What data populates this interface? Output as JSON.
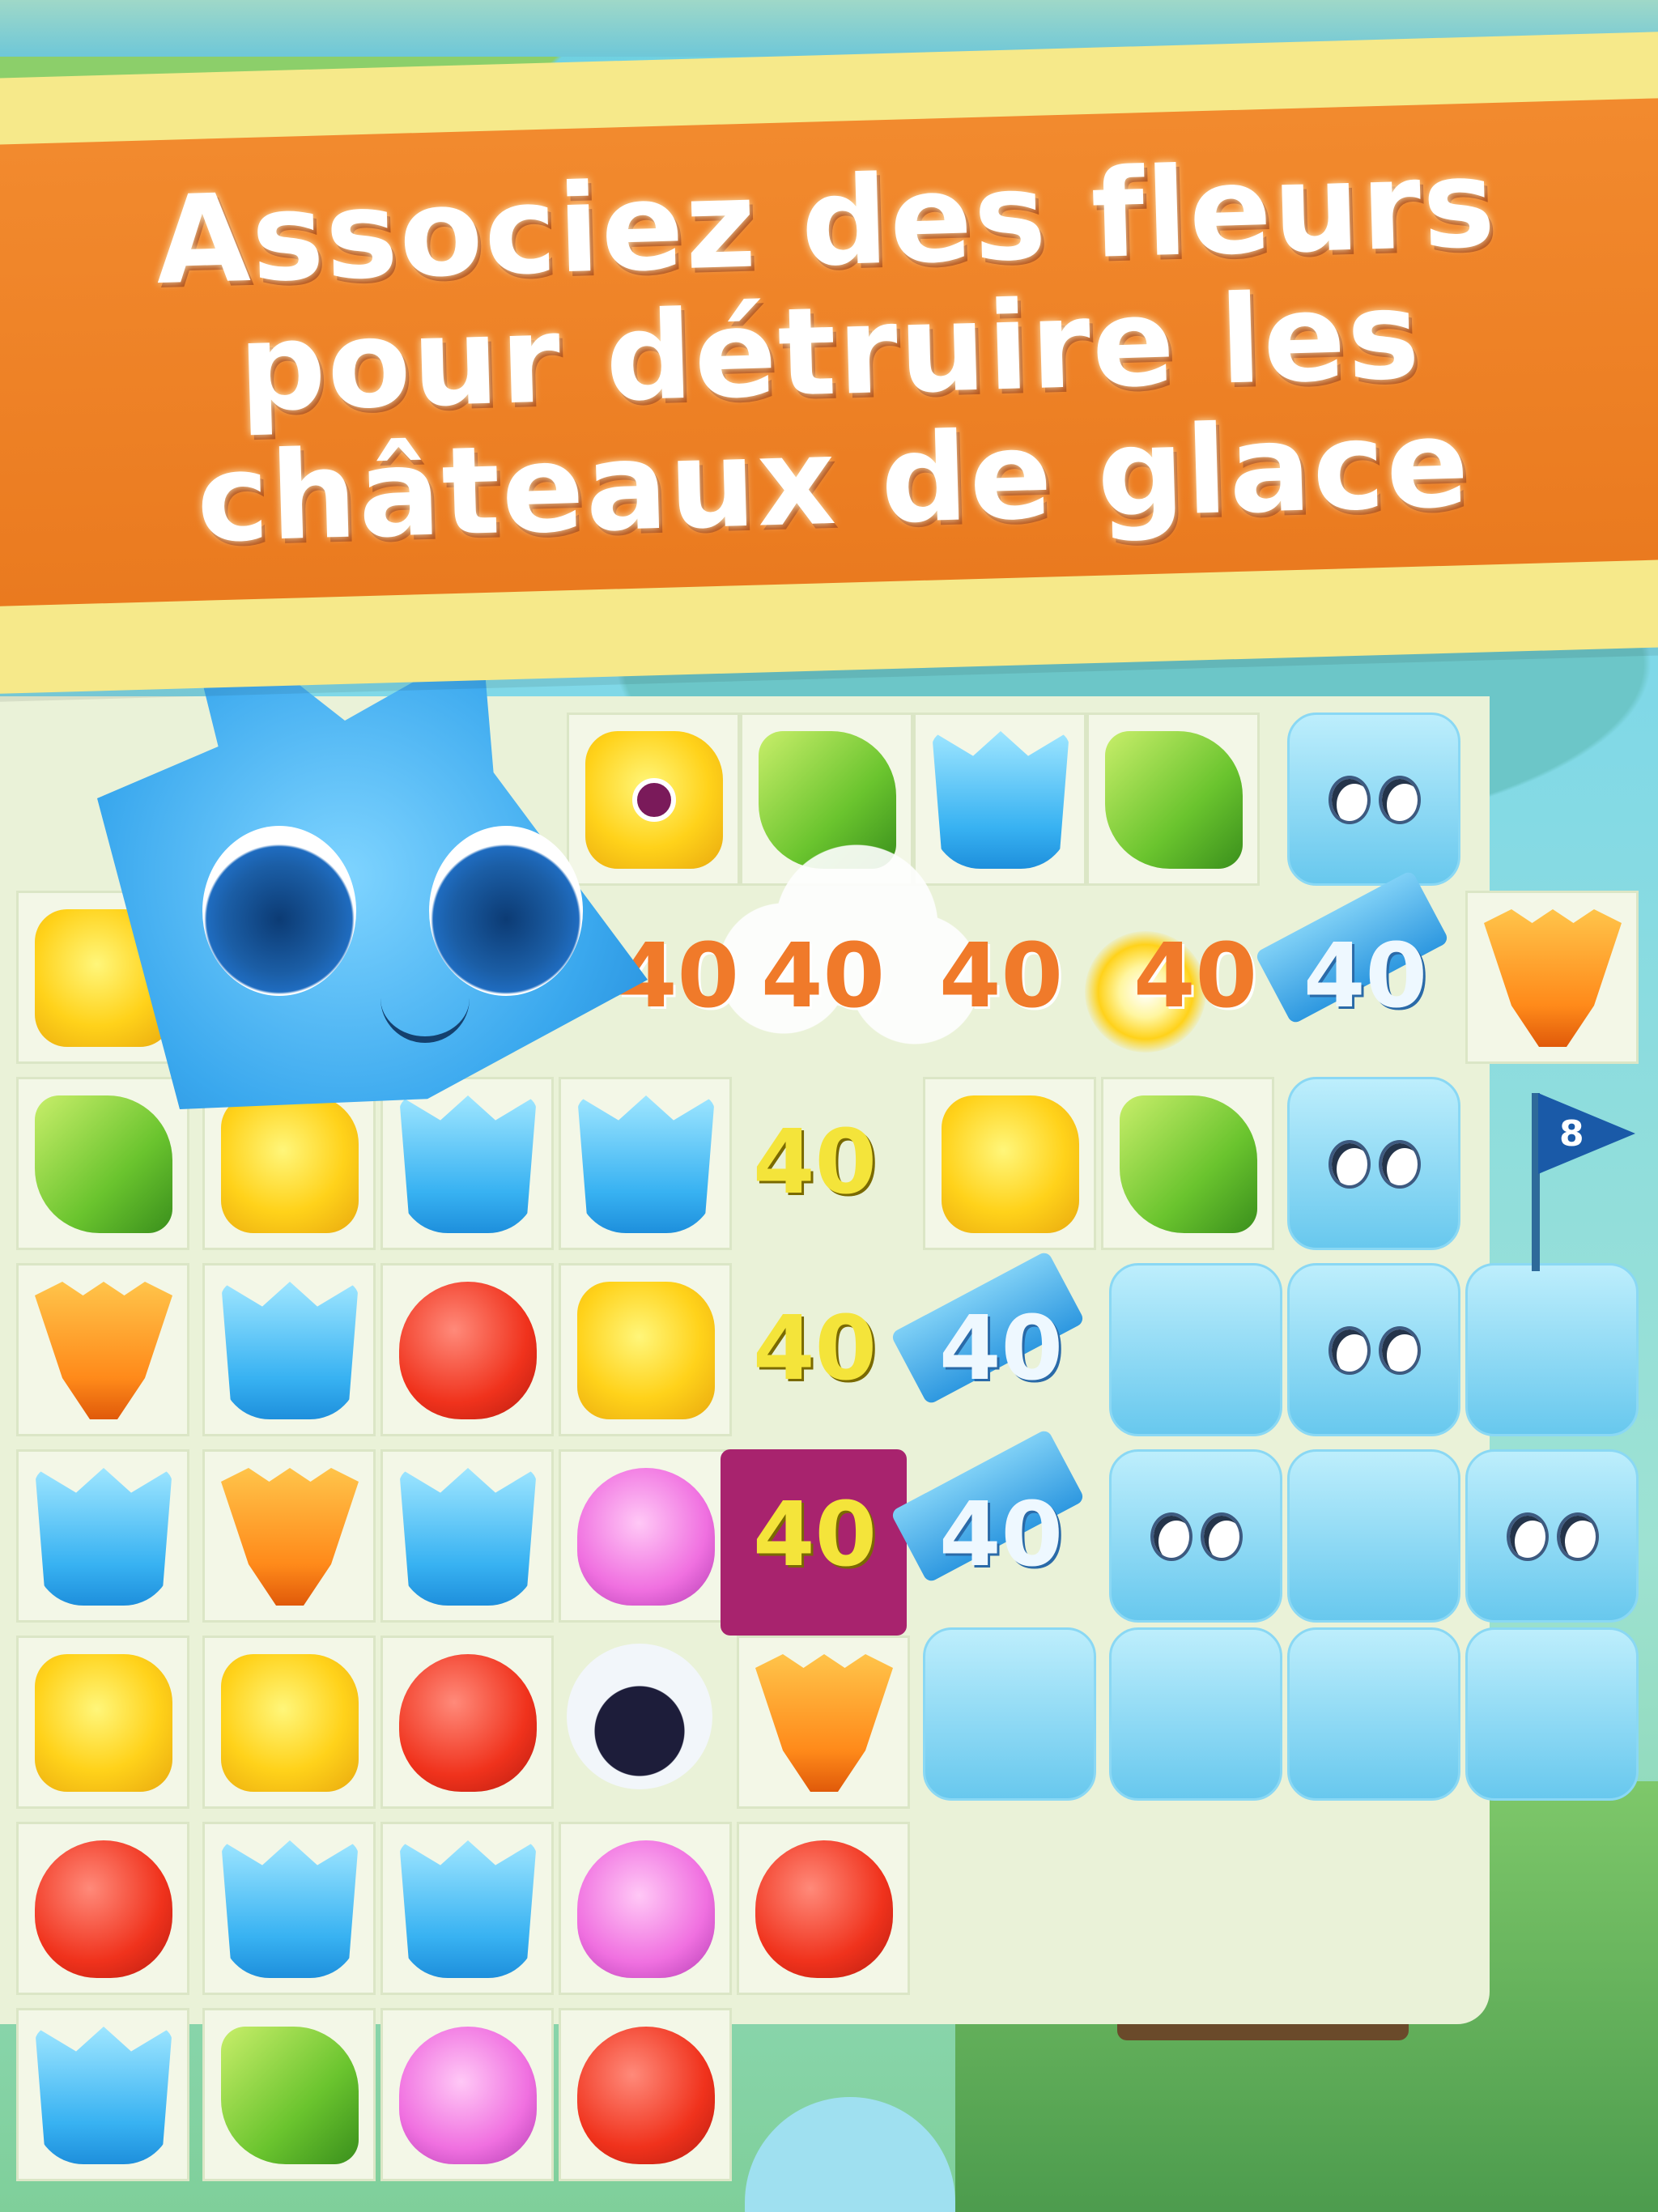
{
  "banner": {
    "line1": "Associez des fleurs",
    "line2": "pour détruire les",
    "line3": "châteaux de glace"
  },
  "board": {
    "score_popups": {
      "a": "40",
      "b": "40",
      "c": "40",
      "d": "40",
      "e": "40",
      "f": "40",
      "g": "40",
      "h": "40",
      "i": "40",
      "j": "40"
    },
    "flag_label": "8"
  },
  "colors": {
    "banner_orange": "#f28a2e",
    "banner_frame": "#f6e98a",
    "ice_blue": "#68c8ee"
  }
}
